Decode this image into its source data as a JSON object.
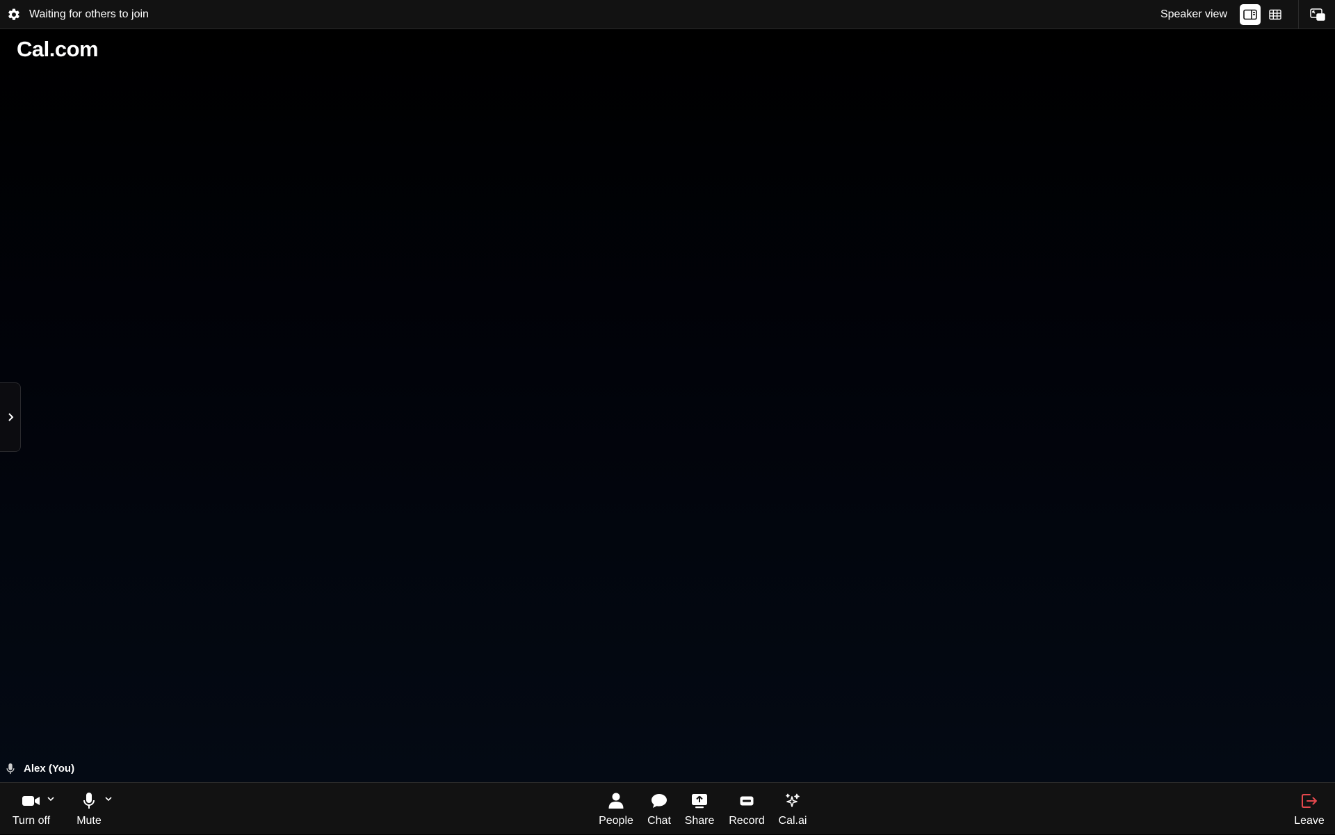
{
  "topbar": {
    "status": "Waiting for others to join",
    "view_label": "Speaker view"
  },
  "stage": {
    "logo": "Cal.com",
    "participant_name": "Alex (You)"
  },
  "controls": {
    "camera_label": "Turn off",
    "mic_label": "Mute",
    "people_label": "People",
    "chat_label": "Chat",
    "share_label": "Share",
    "record_label": "Record",
    "calai_label": "Cal.ai",
    "leave_label": "Leave"
  },
  "colors": {
    "background": "#000000",
    "bar": "#121212",
    "leave": "#e5484d"
  },
  "icons": [
    "gear-icon",
    "speaker-view-icon",
    "grid-view-icon",
    "picture-in-picture-icon",
    "chevron-right-icon",
    "microphone-icon",
    "camera-icon",
    "chevron-down-icon",
    "person-icon",
    "chat-bubble-icon",
    "share-screen-icon",
    "record-icon",
    "sparkle-icon",
    "leave-icon"
  ]
}
